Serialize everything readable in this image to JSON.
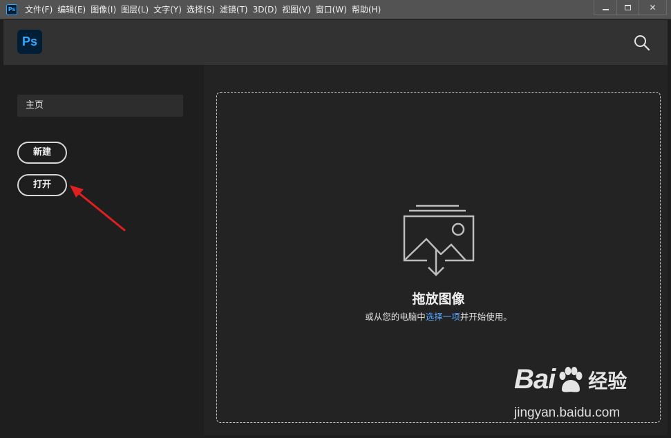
{
  "app": {
    "logo_small": "Ps",
    "logo": "Ps"
  },
  "menubar": {
    "items": [
      "文件(F)",
      "编辑(E)",
      "图像(I)",
      "图层(L)",
      "文字(Y)",
      "选择(S)",
      "滤镜(T)",
      "3D(D)",
      "视图(V)",
      "窗口(W)",
      "帮助(H)"
    ]
  },
  "window_controls": {
    "minimize_icon": "minimize-icon",
    "maximize_icon": "maximize-icon",
    "close_glyph": "✕"
  },
  "header": {
    "search_icon": "search-icon"
  },
  "sidebar": {
    "home_label": "主页",
    "new_button": "新建",
    "open_button": "打开"
  },
  "dropzone": {
    "title": "拖放图像",
    "subtitle_prefix": "或从您的电脑中",
    "subtitle_link": "选择一项",
    "subtitle_suffix": "并开始使用。",
    "icon": "image-download-icon"
  },
  "watermark": {
    "brand_left": "Bai",
    "brand_right": "经验",
    "url": "jingyan.baidu.com"
  },
  "colors": {
    "accent_blue": "#31a8ff",
    "link_blue": "#5aa6ff",
    "annotation_red": "#e02020",
    "background": "#1e1e1e"
  }
}
